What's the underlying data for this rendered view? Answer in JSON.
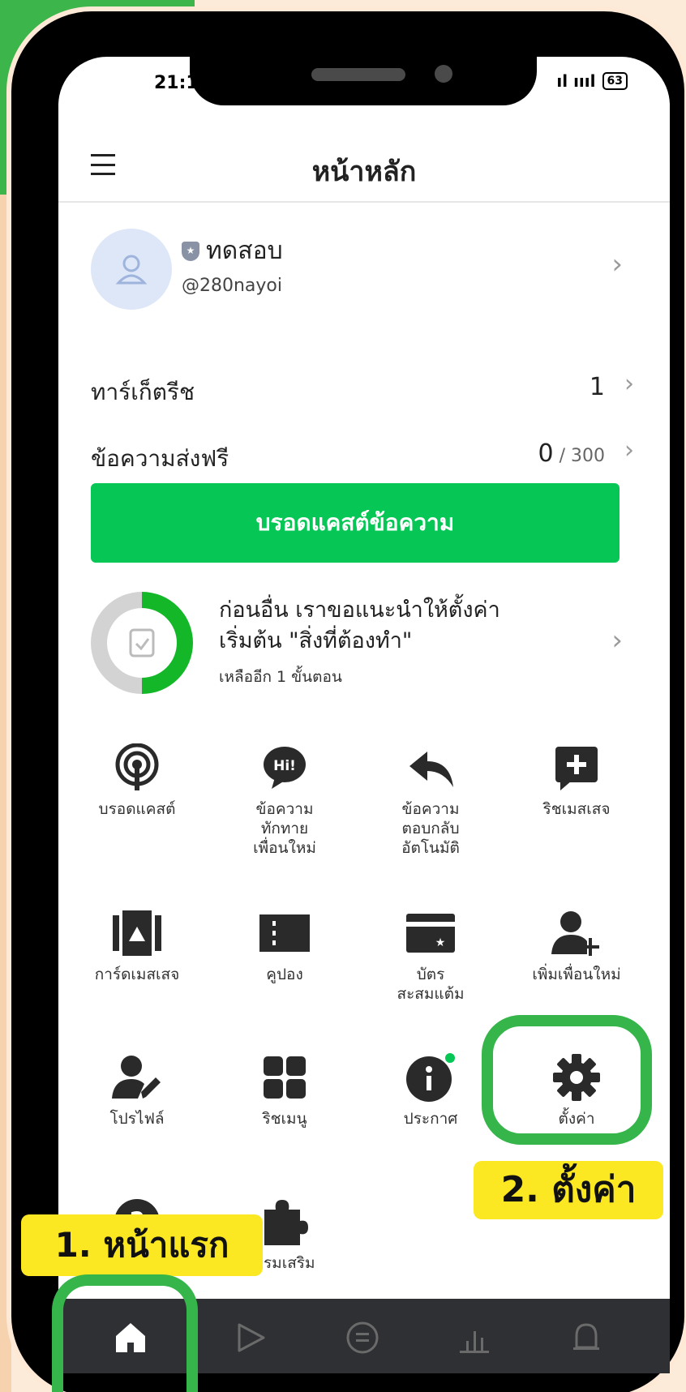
{
  "status": {
    "time": "21:1",
    "signal": "ıl ıııl",
    "battery": "63"
  },
  "header": {
    "title": "หน้าหลัก"
  },
  "account": {
    "name": "ทดสอบ",
    "id": "@280nayoi"
  },
  "rows": [
    {
      "label": "ทาร์เก็ตรีช",
      "value": "1",
      "total": ""
    },
    {
      "label": "ข้อความส่งฟรี",
      "value": "0",
      "total": " / 300"
    }
  ],
  "broadcast_button": "บรอดแคสต์ข้อความ",
  "setup": {
    "line1": "ก่อนอื่น เราขอแนะนำให้ตั้งค่า",
    "line2": "เริ่มต้น \"สิ่งที่ต้องทำ\"",
    "sub": "เหลืออีก 1 ขั้นตอน",
    "progress": 0.5
  },
  "menu": [
    {
      "label": "บรอดแคสต์",
      "icon": "broadcast-icon"
    },
    {
      "label": "ข้อความ\nทักทาย\nเพื่อนใหม่",
      "icon": "greeting-icon"
    },
    {
      "label": "ข้อความ\nตอบกลับ\nอัตโนมัติ",
      "icon": "reply-icon"
    },
    {
      "label": "ริชเมสเสจ",
      "icon": "rich-message-icon"
    },
    {
      "label": "การ์ดเมสเสจ",
      "icon": "card-message-icon"
    },
    {
      "label": "คูปอง",
      "icon": "coupon-icon"
    },
    {
      "label": "บัตร\nสะสมแต้ม",
      "icon": "reward-card-icon"
    },
    {
      "label": "เพิ่มเพื่อนใหม่",
      "icon": "add-friend-icon"
    },
    {
      "label": "โปรไฟล์",
      "icon": "profile-edit-icon"
    },
    {
      "label": "ริชเมนู",
      "icon": "rich-menu-icon"
    },
    {
      "label": "ประกาศ",
      "icon": "info-icon"
    },
    {
      "label": "ตั้งค่า",
      "icon": "settings-gear-icon"
    },
    {
      "label": "",
      "icon": "help-icon"
    },
    {
      "label": "กรมเสริม",
      "icon": "extension-icon"
    }
  ],
  "callouts": {
    "home": "1. หน้าแรก",
    "settings": "2. ตั้งค่า"
  },
  "colors": {
    "line_green": "#06c755",
    "highlight_green": "#35b54a",
    "callout_yellow": "#fbe822",
    "nav_dark": "#2f3033"
  }
}
